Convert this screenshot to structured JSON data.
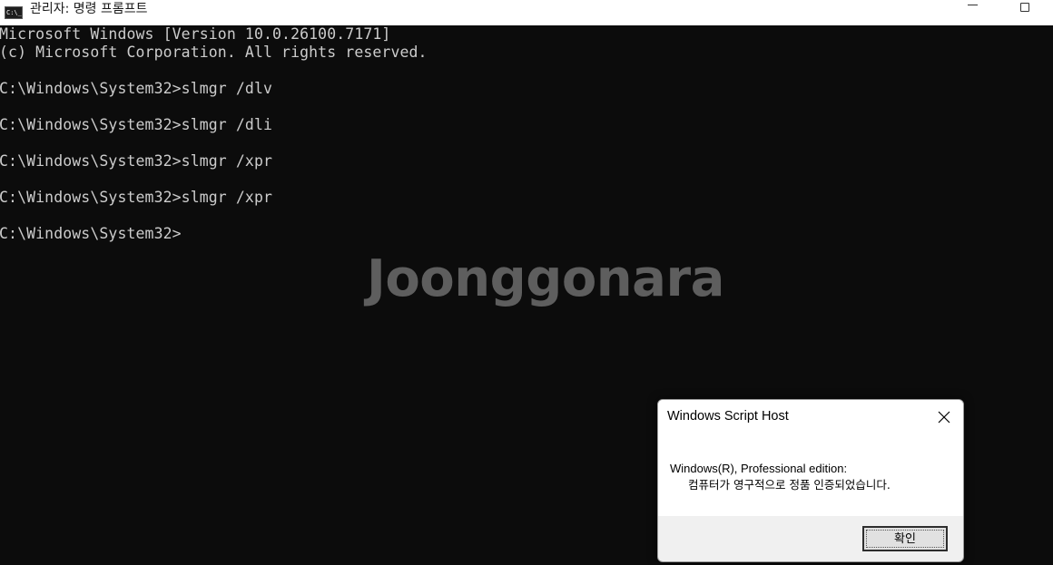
{
  "window": {
    "title": "관리자: 명령 프롬프트",
    "icon_label": "C:\\_"
  },
  "console": {
    "lines": [
      "Microsoft Windows [Version 10.0.26100.7171]",
      "(c) Microsoft Corporation. All rights reserved.",
      "",
      "C:\\Windows\\System32>slmgr /dlv",
      "",
      "C:\\Windows\\System32>slmgr /dli",
      "",
      "C:\\Windows\\System32>slmgr /xpr",
      "",
      "C:\\Windows\\System32>slmgr /xpr",
      "",
      "C:\\Windows\\System32>"
    ]
  },
  "watermark": {
    "text": "Joonggonara"
  },
  "dialog": {
    "title": "Windows Script Host",
    "message_line1": "Windows(R), Professional edition:",
    "message_line2": "컴퓨터가 영구적으로 정품 인증되었습니다.",
    "ok_label": "확인"
  },
  "colors": {
    "console_bg": "#0c0c0c",
    "console_text": "#cccccc",
    "watermark": "#5e5e5e"
  }
}
